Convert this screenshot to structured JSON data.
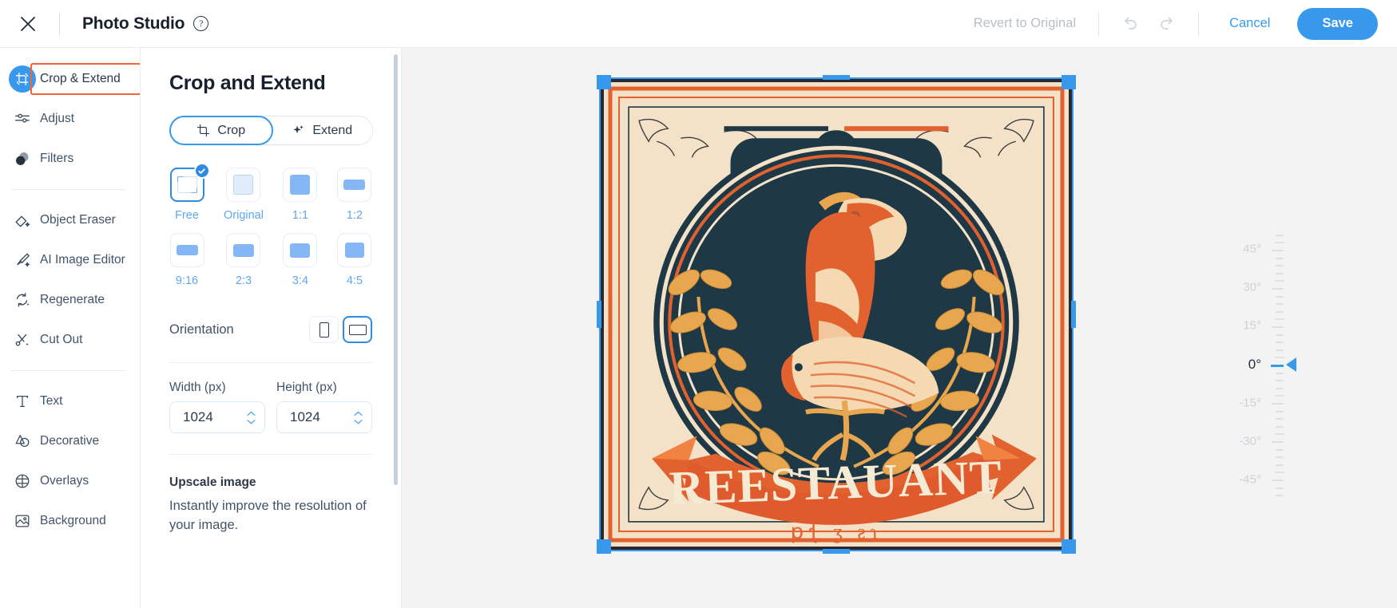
{
  "header": {
    "close_icon": "close-icon",
    "title": "Photo Studio",
    "help_icon": "help-circle-icon",
    "revert_label": "Revert to Original",
    "undo_icon": "undo-icon",
    "redo_icon": "redo-icon",
    "cancel_label": "Cancel",
    "save_label": "Save"
  },
  "sidebar": {
    "items": [
      {
        "label": "Crop & Extend",
        "icon": "crop-rotate-icon",
        "active": true,
        "highlighted": true
      },
      {
        "label": "Adjust",
        "icon": "sliders-icon"
      },
      {
        "label": "Filters",
        "icon": "filters-circle-icon"
      },
      {
        "label": "Object Eraser",
        "icon": "eraser-sparkle-icon"
      },
      {
        "label": "AI Image Editor",
        "icon": "brush-sparkle-icon"
      },
      {
        "label": "Regenerate",
        "icon": "regenerate-sparkle-icon"
      },
      {
        "label": "Cut Out",
        "icon": "scissors-sparkle-icon"
      },
      {
        "label": "Text",
        "icon": "text-t-icon"
      },
      {
        "label": "Decorative",
        "icon": "shapes-icon"
      },
      {
        "label": "Overlays",
        "icon": "overlays-icon"
      },
      {
        "label": "Background",
        "icon": "background-icon"
      }
    ]
  },
  "panel": {
    "title": "Crop and Extend",
    "mode_tabs": [
      {
        "label": "Crop",
        "icon": "crop-icon",
        "active": true
      },
      {
        "label": "Extend",
        "icon": "sparkle-icon",
        "active": false
      }
    ],
    "ratios": [
      {
        "label": "Free",
        "selected": true,
        "shape": "free"
      },
      {
        "label": "Original",
        "selected": false,
        "shape": "square-outline"
      },
      {
        "label": "1:1",
        "selected": false,
        "shape": "square"
      },
      {
        "label": "1:2",
        "selected": false,
        "shape": "wide"
      },
      {
        "label": "9:16",
        "selected": false,
        "shape": "wide"
      },
      {
        "label": "2:3",
        "selected": false,
        "shape": "wide2"
      },
      {
        "label": "3:4",
        "selected": false,
        "shape": "wide3"
      },
      {
        "label": "4:5",
        "selected": false,
        "shape": "wide4"
      }
    ],
    "orientation": {
      "label": "Orientation",
      "portrait_icon": "portrait-icon",
      "landscape_icon": "landscape-icon",
      "selected": "landscape"
    },
    "width": {
      "label": "Width (px)",
      "value": "1024",
      "stepper_icon": "stepper-icon"
    },
    "height": {
      "label": "Height (px)",
      "value": "1024",
      "stepper_icon": "stepper-icon"
    },
    "upscale": {
      "title": "Upscale image",
      "description": "Instantly improve the resolution of your image."
    }
  },
  "canvas": {
    "rotation": {
      "value": "0°",
      "labels": [
        "45°",
        "30°",
        "15°",
        "0°",
        "-15°",
        "-30°",
        "-45°"
      ]
    },
    "image": {
      "alt": "restaurant-emblem",
      "banner_text": "REESTAUANT",
      "sub_text": "ꝑꞎ ʒ ƨɿ",
      "colors": {
        "paper": "#f3e2c8",
        "navy": "#1e3845",
        "orange": "#e2622f",
        "gold": "#e8a74e",
        "frame": "#2a2730"
      }
    },
    "crop_handle_color": "#3899ec"
  }
}
